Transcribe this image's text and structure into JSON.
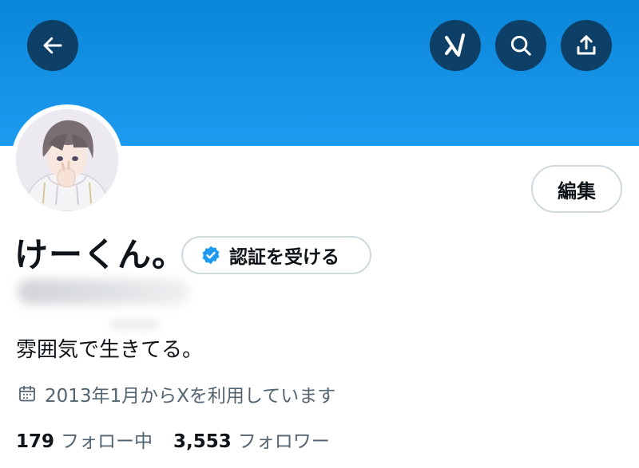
{
  "header": {
    "back_icon": "arrow-left-icon",
    "grok_icon": "grok-icon",
    "search_icon": "search-icon",
    "share_icon": "share-icon",
    "banner_color": "#1d9bf0",
    "button_color": "#0e3f66"
  },
  "profile": {
    "display_name": "けーくん。",
    "verify_label": "認証を受ける",
    "verify_icon": "verified-badge-icon",
    "edit_label": "編集",
    "bio": "雰囲気で生きてる。",
    "joined_icon": "calendar-icon",
    "joined_text": "2013年1月からXを利用しています",
    "following_count": "179",
    "following_label": "フォロー中",
    "followers_count": "3,553",
    "followers_label": "フォロワー"
  }
}
